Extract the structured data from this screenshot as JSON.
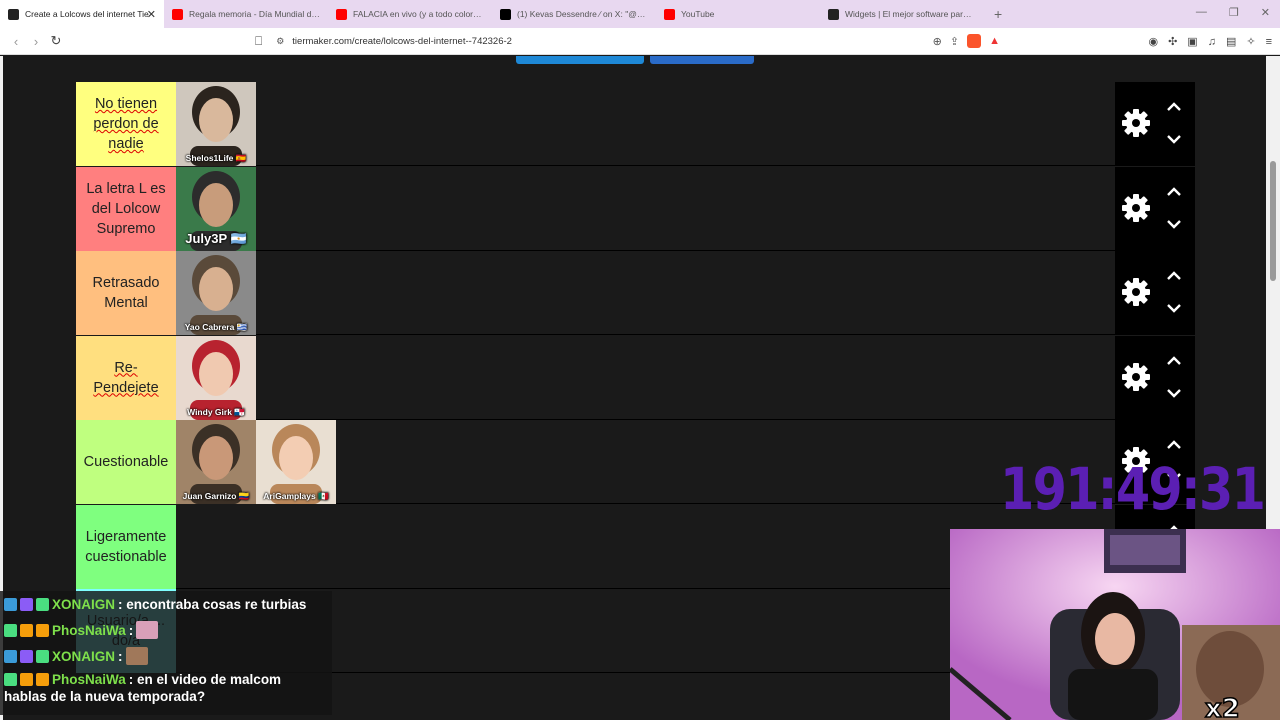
{
  "browser": {
    "tabs": [
      {
        "title": "Create a Lolcows del internet Tie",
        "icon": "tiermaker-icon",
        "color": "#222222",
        "active": true
      },
      {
        "title": "Regala memoria - Día Mundial del Al",
        "icon": "youtube-icon",
        "color": "#ff0000",
        "active": false
      },
      {
        "title": "FALACIA en vivo (y a todo color) - Ri",
        "icon": "youtube-icon",
        "color": "#ff0000",
        "active": false
      },
      {
        "title": "(1) Kevas Dessendre ∕ on X: \"@Hac",
        "icon": "x-icon",
        "color": "#000000",
        "active": false
      },
      {
        "title": "YouTube",
        "icon": "youtube-icon",
        "color": "#ff0000",
        "active": false
      },
      {
        "title": "Widgets | El mejor software para po:",
        "icon": "streamelements-icon",
        "color": "#222222",
        "active": false
      }
    ],
    "url": "tiermaker.com/create/lolcows-del-internet--742326-2"
  },
  "tiers": [
    {
      "label": "No tienen perdon de nadie",
      "color": "#ffff7f",
      "underline": true,
      "items": [
        "Shelos1Life 🇪🇸"
      ]
    },
    {
      "label": "La letra L es del Lolcow Supremo",
      "color": "#ff7f7f",
      "underline": false,
      "items": [
        "July3P 🇦🇷"
      ]
    },
    {
      "label": "Retrasado Mental",
      "color": "#ffbf7f",
      "underline": false,
      "items": [
        "Yao Cabrera 🇺🇾"
      ]
    },
    {
      "label": "Re-Pendejete",
      "color": "#ffdf7f",
      "underline": true,
      "items": [
        "Windy Girk 🇵🇦"
      ]
    },
    {
      "label": "Cuestionable",
      "color": "#bfff7f",
      "underline": false,
      "items": [
        "Juan Garnizo 🇨🇴",
        "AriGamplays 🇲🇽"
      ]
    },
    {
      "label": "Ligeramente cuestionable",
      "color": "#7fff7f",
      "underline": false,
      "items": []
    },
    {
      "label": "Usuario/a ... do/a",
      "color": "#7fffff",
      "underline": false,
      "items": []
    }
  ],
  "timer": "191:49:31",
  "chat": [
    {
      "user": "XONAIGN",
      "text": ": encontraba cosas re turbias"
    },
    {
      "user": "PhosNaiWa",
      "text": ":"
    },
    {
      "user": "XONAIGN",
      "text": ":"
    },
    {
      "user": "PhosNaiWa",
      "text": ": en el video de malcom",
      "text2": "hablas de la nueva temporada?"
    }
  ]
}
